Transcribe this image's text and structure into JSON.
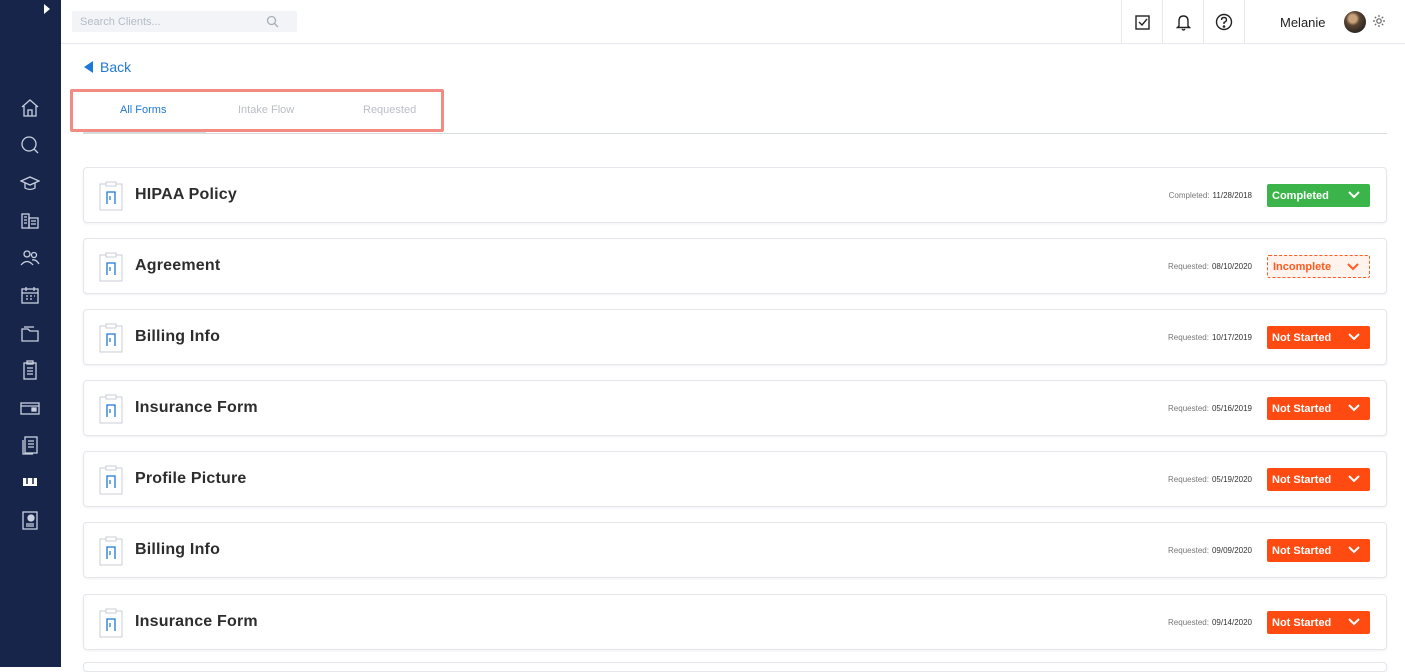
{
  "search": {
    "placeholder": "Search Clients..."
  },
  "user": {
    "name": "Melanie"
  },
  "sidebar": {
    "icons": [
      "home-icon",
      "chat-icon",
      "graduation-cap-icon",
      "buildings-icon",
      "users-icon",
      "calendar-icon",
      "folder-icon",
      "clipboard-icon",
      "credit-card-icon",
      "documents-icon",
      "bookmarks-icon",
      "report-icon"
    ]
  },
  "back_label": "Back",
  "tabs": [
    {
      "label": "All Forms"
    },
    {
      "label": "Intake Flow"
    },
    {
      "label": "Requested"
    }
  ],
  "forms": [
    {
      "title": "HIPAA Policy",
      "date_label": "Completed:",
      "date": "11/28/2018",
      "status": "Completed"
    },
    {
      "title": "Agreement",
      "date_label": "Requested:",
      "date": "08/10/2020",
      "status": "Incomplete"
    },
    {
      "title": "Billing Info",
      "date_label": "Requested:",
      "date": "10/17/2019",
      "status": "Not Started"
    },
    {
      "title": "Insurance Form",
      "date_label": "Requested:",
      "date": "05/16/2019",
      "status": "Not Started"
    },
    {
      "title": "Profile Picture",
      "date_label": "Requested:",
      "date": "05/19/2020",
      "status": "Not Started"
    },
    {
      "title": "Billing Info",
      "date_label": "Requested:",
      "date": "09/09/2020",
      "status": "Not Started"
    },
    {
      "title": "Insurance Form",
      "date_label": "Requested:",
      "date": "09/14/2020",
      "status": "Not Started"
    }
  ],
  "colors": {
    "sidebar": "#17254a",
    "accent": "#1e78d6",
    "completed": "#3bb54a",
    "not_started": "#ff4a12",
    "incomplete": "#ff5a1f",
    "highlight": "#f28b82"
  }
}
